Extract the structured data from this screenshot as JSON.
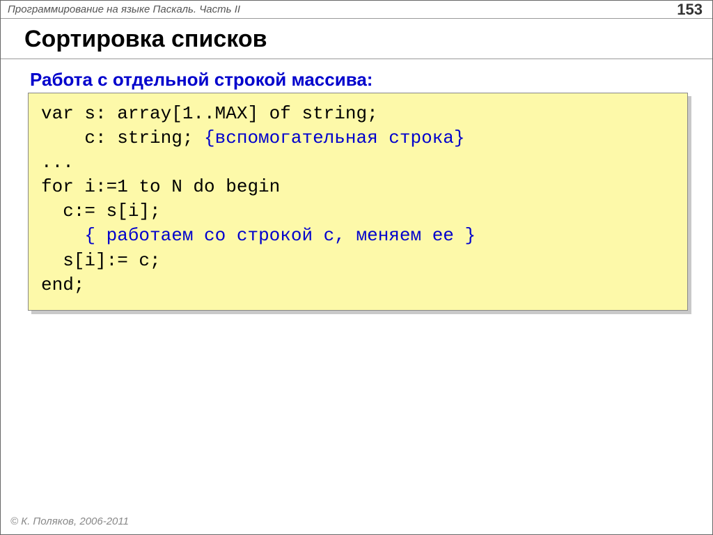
{
  "header": {
    "doc_title": "Программирование на языке Паскаль. Часть II",
    "page_number": "153"
  },
  "title": "Сортировка списков",
  "subtitle": "Работа с отдельной строкой массива:",
  "code": {
    "l1": "var s: array[1..MAX] of string;",
    "l2a": "    c: string; ",
    "l2b": "{вспомогательная строка}",
    "l3": "...",
    "l4": "for i:=1 to N do begin",
    "l5": "  c:= s[i];",
    "l6a": "    ",
    "l6b": "{ работаем со строкой c, меняем ее }",
    "l7": "  s[i]:= c;",
    "l8": "end;"
  },
  "footer": {
    "symbol": "©",
    "text": " К. Поляков, 2006-2011"
  }
}
